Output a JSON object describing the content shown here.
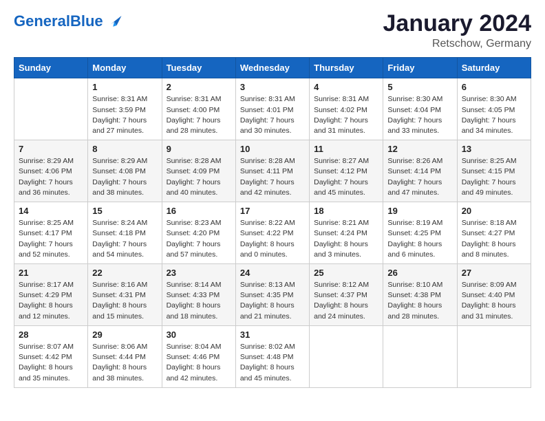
{
  "header": {
    "logo_general": "General",
    "logo_blue": "Blue",
    "title": "January 2024",
    "subtitle": "Retschow, Germany"
  },
  "days_of_week": [
    "Sunday",
    "Monday",
    "Tuesday",
    "Wednesday",
    "Thursday",
    "Friday",
    "Saturday"
  ],
  "weeks": [
    [
      {
        "day": "",
        "info": ""
      },
      {
        "day": "1",
        "info": "Sunrise: 8:31 AM\nSunset: 3:59 PM\nDaylight: 7 hours\nand 27 minutes."
      },
      {
        "day": "2",
        "info": "Sunrise: 8:31 AM\nSunset: 4:00 PM\nDaylight: 7 hours\nand 28 minutes."
      },
      {
        "day": "3",
        "info": "Sunrise: 8:31 AM\nSunset: 4:01 PM\nDaylight: 7 hours\nand 30 minutes."
      },
      {
        "day": "4",
        "info": "Sunrise: 8:31 AM\nSunset: 4:02 PM\nDaylight: 7 hours\nand 31 minutes."
      },
      {
        "day": "5",
        "info": "Sunrise: 8:30 AM\nSunset: 4:04 PM\nDaylight: 7 hours\nand 33 minutes."
      },
      {
        "day": "6",
        "info": "Sunrise: 8:30 AM\nSunset: 4:05 PM\nDaylight: 7 hours\nand 34 minutes."
      }
    ],
    [
      {
        "day": "7",
        "info": "Sunrise: 8:29 AM\nSunset: 4:06 PM\nDaylight: 7 hours\nand 36 minutes."
      },
      {
        "day": "8",
        "info": "Sunrise: 8:29 AM\nSunset: 4:08 PM\nDaylight: 7 hours\nand 38 minutes."
      },
      {
        "day": "9",
        "info": "Sunrise: 8:28 AM\nSunset: 4:09 PM\nDaylight: 7 hours\nand 40 minutes."
      },
      {
        "day": "10",
        "info": "Sunrise: 8:28 AM\nSunset: 4:11 PM\nDaylight: 7 hours\nand 42 minutes."
      },
      {
        "day": "11",
        "info": "Sunrise: 8:27 AM\nSunset: 4:12 PM\nDaylight: 7 hours\nand 45 minutes."
      },
      {
        "day": "12",
        "info": "Sunrise: 8:26 AM\nSunset: 4:14 PM\nDaylight: 7 hours\nand 47 minutes."
      },
      {
        "day": "13",
        "info": "Sunrise: 8:25 AM\nSunset: 4:15 PM\nDaylight: 7 hours\nand 49 minutes."
      }
    ],
    [
      {
        "day": "14",
        "info": "Sunrise: 8:25 AM\nSunset: 4:17 PM\nDaylight: 7 hours\nand 52 minutes."
      },
      {
        "day": "15",
        "info": "Sunrise: 8:24 AM\nSunset: 4:18 PM\nDaylight: 7 hours\nand 54 minutes."
      },
      {
        "day": "16",
        "info": "Sunrise: 8:23 AM\nSunset: 4:20 PM\nDaylight: 7 hours\nand 57 minutes."
      },
      {
        "day": "17",
        "info": "Sunrise: 8:22 AM\nSunset: 4:22 PM\nDaylight: 8 hours\nand 0 minutes."
      },
      {
        "day": "18",
        "info": "Sunrise: 8:21 AM\nSunset: 4:24 PM\nDaylight: 8 hours\nand 3 minutes."
      },
      {
        "day": "19",
        "info": "Sunrise: 8:19 AM\nSunset: 4:25 PM\nDaylight: 8 hours\nand 6 minutes."
      },
      {
        "day": "20",
        "info": "Sunrise: 8:18 AM\nSunset: 4:27 PM\nDaylight: 8 hours\nand 8 minutes."
      }
    ],
    [
      {
        "day": "21",
        "info": "Sunrise: 8:17 AM\nSunset: 4:29 PM\nDaylight: 8 hours\nand 12 minutes."
      },
      {
        "day": "22",
        "info": "Sunrise: 8:16 AM\nSunset: 4:31 PM\nDaylight: 8 hours\nand 15 minutes."
      },
      {
        "day": "23",
        "info": "Sunrise: 8:14 AM\nSunset: 4:33 PM\nDaylight: 8 hours\nand 18 minutes."
      },
      {
        "day": "24",
        "info": "Sunrise: 8:13 AM\nSunset: 4:35 PM\nDaylight: 8 hours\nand 21 minutes."
      },
      {
        "day": "25",
        "info": "Sunrise: 8:12 AM\nSunset: 4:37 PM\nDaylight: 8 hours\nand 24 minutes."
      },
      {
        "day": "26",
        "info": "Sunrise: 8:10 AM\nSunset: 4:38 PM\nDaylight: 8 hours\nand 28 minutes."
      },
      {
        "day": "27",
        "info": "Sunrise: 8:09 AM\nSunset: 4:40 PM\nDaylight: 8 hours\nand 31 minutes."
      }
    ],
    [
      {
        "day": "28",
        "info": "Sunrise: 8:07 AM\nSunset: 4:42 PM\nDaylight: 8 hours\nand 35 minutes."
      },
      {
        "day": "29",
        "info": "Sunrise: 8:06 AM\nSunset: 4:44 PM\nDaylight: 8 hours\nand 38 minutes."
      },
      {
        "day": "30",
        "info": "Sunrise: 8:04 AM\nSunset: 4:46 PM\nDaylight: 8 hours\nand 42 minutes."
      },
      {
        "day": "31",
        "info": "Sunrise: 8:02 AM\nSunset: 4:48 PM\nDaylight: 8 hours\nand 45 minutes."
      },
      {
        "day": "",
        "info": ""
      },
      {
        "day": "",
        "info": ""
      },
      {
        "day": "",
        "info": ""
      }
    ]
  ]
}
